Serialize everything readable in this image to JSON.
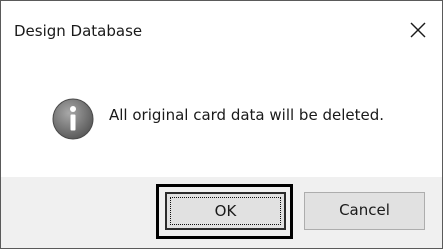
{
  "dialog": {
    "title": "Design Database",
    "message": "All original card data will be deleted.",
    "icon": "info-icon",
    "close_icon": "close-icon"
  },
  "buttons": {
    "ok_label": "OK",
    "cancel_label": "Cancel"
  },
  "colors": {
    "footer_bg": "#f0f0f0",
    "button_bg": "#e1e1e1",
    "icon_gray": "#7a7a7a"
  }
}
